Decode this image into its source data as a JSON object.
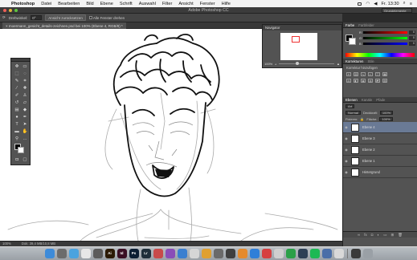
{
  "menubar": {
    "apple_icon": "apple-icon",
    "items": [
      "Photoshop",
      "Datei",
      "Bearbeiten",
      "Bild",
      "Ebene",
      "Schrift",
      "Auswahl",
      "Filter",
      "Ansicht",
      "Fenster",
      "Hilfe"
    ],
    "clock": "Fr. 13:30"
  },
  "window": {
    "title": "Adobe Photoshop CC",
    "workspace": "Grundelemente"
  },
  "options": {
    "rotation_label": "Drehwinkel:",
    "rotation_value": "0°",
    "reset_label": "Ansicht zurücksetzen",
    "rotate_all_label": "Alle Fenster drehen"
  },
  "document": {
    "tab": "moermann_gesicht_details-zeichnen.psd bei 100% (Ebene 4, RGB/8) *"
  },
  "status": {
    "zoom": "100%",
    "doc_info": "Dok: 39,4 MB/10,8 MB"
  },
  "navigator": {
    "title": "Navigator",
    "zoom": "100%"
  },
  "color_panel": {
    "tabs": [
      "Farbe",
      "Farbfelder"
    ],
    "channels": [
      {
        "label": "R",
        "value": "0"
      },
      {
        "label": "G",
        "value": "0"
      },
      {
        "label": "B",
        "value": "0"
      }
    ],
    "foreground": "#000000",
    "background": "#ffffff"
  },
  "adjust_panel": {
    "tabs": [
      "Korrekturen",
      "Stile"
    ],
    "subtitle": "Korrektur hinzufügen"
  },
  "layers_panel": {
    "tabs": [
      "Ebenen",
      "Kanäle",
      "Pfade"
    ],
    "filter_label": "Art",
    "blend_mode": "Normal",
    "opacity_label": "Deckkraft:",
    "opacity_value": "100%",
    "lock_label": "Fixieren:",
    "fill_label": "Fläche:",
    "fill_value": "100%",
    "layers": [
      {
        "name": "Ebene 4",
        "active": true
      },
      {
        "name": "Ebene 3",
        "active": false
      },
      {
        "name": "Ebene 2",
        "active": false
      },
      {
        "name": "Ebene 1",
        "active": false
      },
      {
        "name": "Hintergrund",
        "active": false
      }
    ]
  },
  "dock": {
    "apps": [
      {
        "label": "",
        "color": "#3d8bd9"
      },
      {
        "label": "",
        "color": "#6c6c6c"
      },
      {
        "label": "",
        "color": "#4aa3df"
      },
      {
        "label": "",
        "color": "#e7e7e7"
      },
      {
        "label": "",
        "color": "#5b5b5b"
      },
      {
        "label": "Ai",
        "color": "#2b1a05"
      },
      {
        "label": "Id",
        "color": "#3a0f24"
      },
      {
        "label": "Ps",
        "color": "#0b1e33"
      },
      {
        "label": "Lr",
        "color": "#1f2f3a"
      },
      {
        "label": "",
        "color": "#c84a4a"
      },
      {
        "label": "",
        "color": "#8a4db8"
      },
      {
        "label": "",
        "color": "#3a7fd0"
      },
      {
        "label": "",
        "color": "#d6d6d6"
      },
      {
        "label": "",
        "color": "#e0a030"
      },
      {
        "label": "",
        "color": "#6a6a6a"
      },
      {
        "label": "",
        "color": "#3f3f3f"
      },
      {
        "label": "",
        "color": "#e58a2c"
      },
      {
        "label": "",
        "color": "#2f7fd8"
      },
      {
        "label": "",
        "color": "#d64040"
      },
      {
        "label": "",
        "color": "#cfcfcf"
      },
      {
        "label": "",
        "color": "#2aa048"
      },
      {
        "label": "",
        "color": "#2d3f55"
      },
      {
        "label": "",
        "color": "#1db954"
      },
      {
        "label": "",
        "color": "#4a6ea8"
      },
      {
        "label": "",
        "color": "#d9d9d9"
      },
      {
        "label": "",
        "color": "#3a3a3a"
      },
      {
        "label": "",
        "color": "#9aa0a6"
      }
    ]
  }
}
